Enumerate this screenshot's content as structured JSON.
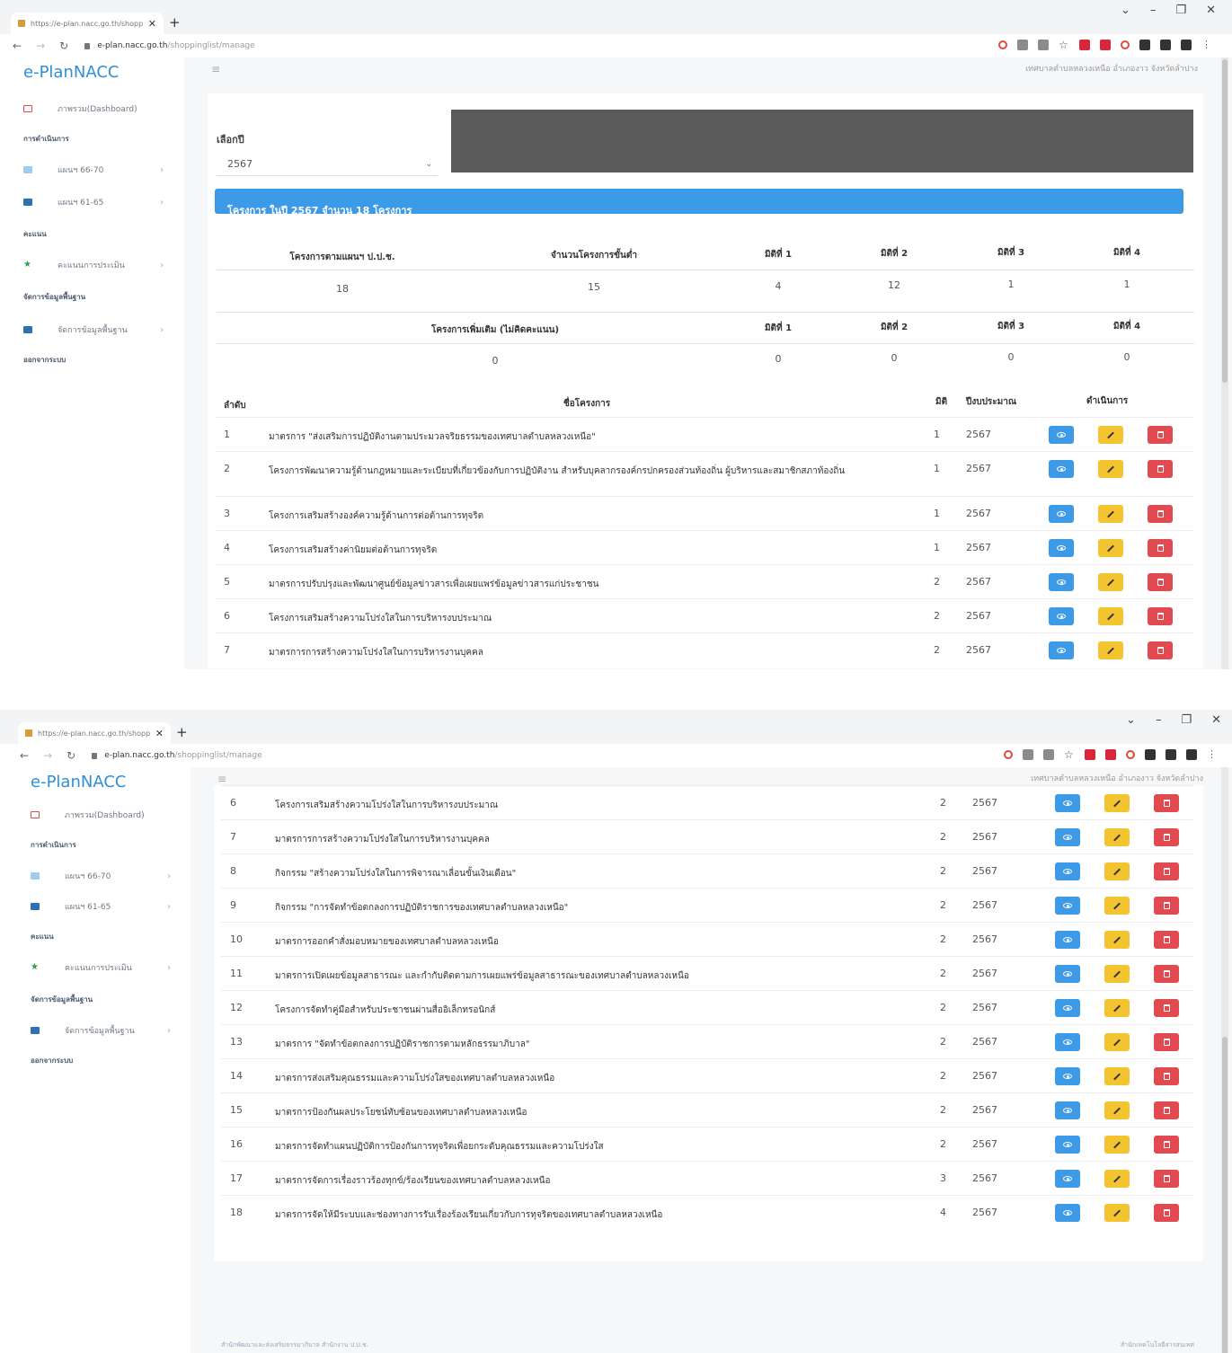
{
  "browser": {
    "tab_title": "https://e-plan.nacc.go.th/shopp",
    "url_host": "e-plan.nacc.go.th",
    "url_path": "/shoppinglist/manage"
  },
  "app": {
    "brand": "e-PlanNACC",
    "org_name": "เทศบาลตำบลหลวงเหนือ อำเภองาว จังหวัดลำปาง"
  },
  "sidebar": {
    "dashboard": "ภาพรวม(Dashboard)",
    "section_operations": "การดำเนินการ",
    "plan_66_70": "แผนฯ 66-70",
    "plan_61_65": "แผนฯ 61-65",
    "section_score": "คะแนน",
    "score_assess": "คะแนนการประเมิน",
    "section_basic": "จัดการข้อมูลพื้นฐาน",
    "basic_manage": "จัดการข้อมูลพื้นฐาน",
    "logout": "ออกจากระบบ"
  },
  "filter": {
    "year_label": "เลือกปี",
    "year_value": "2567"
  },
  "banner": "โครงการ ในปี 2567 จำนวน 18 โครงการ",
  "summary": {
    "headers_main": [
      "โครงการตามแผนฯ ป.ป.ช.",
      "จำนวนโครงการขั้นต่ำ",
      "มิติที่ 1",
      "มิติที่ 2",
      "มิติที่ 3",
      "มิติที่ 4"
    ],
    "values_main": [
      "18",
      "15",
      "4",
      "12",
      "1",
      "1"
    ],
    "headers_extra": [
      "โครงการเพิ่มเติม (ไม่คิดคะแนน)",
      "มิติที่ 1",
      "มิติที่ 2",
      "มิติที่ 3",
      "มิติที่ 4"
    ],
    "values_extra": [
      "0",
      "0",
      "0",
      "0",
      "0"
    ]
  },
  "table": {
    "headers": {
      "no": "ลำดับ",
      "name": "ชื่อโครงการ",
      "dim": "มิติ",
      "year": "ปีงบประมาณ",
      "actions": "ดำเนินการ"
    },
    "rows": [
      {
        "no": "1",
        "name": "มาตรการ \"ส่งเสริมการปฏิบัติงานตามประมวลจริยธรรมของเทศบาลตำบลหลวงเหนือ\"",
        "dim": "1",
        "year": "2567"
      },
      {
        "no": "2",
        "name": "โครงการพัฒนาความรู้ด้านกฎหมายและระเบียบที่เกี่ยวข้องกับการปฏิบัติงาน สำหรับบุคลากรองค์กรปกครองส่วนท้องถิ่น ผู้บริหารและสมาชิกสภาท้องถิ่น",
        "dim": "1",
        "year": "2567"
      },
      {
        "no": "3",
        "name": "โครงการเสริมสร้างองค์ความรู้ด้านการต่อต้านการทุจริต",
        "dim": "1",
        "year": "2567"
      },
      {
        "no": "4",
        "name": "โครงการเสริมสร้างค่านิยมต่อต้านการทุจริต",
        "dim": "1",
        "year": "2567"
      },
      {
        "no": "5",
        "name": "มาตรการปรับปรุงและพัฒนาศูนย์ข้อมูลข่าวสารเพื่อเผยแพร่ข้อมูลข่าวสารแก่ประชาชน",
        "dim": "2",
        "year": "2567"
      },
      {
        "no": "6",
        "name": "โครงการเสริมสร้างความโปร่งใสในการบริหารงบประมาณ",
        "dim": "2",
        "year": "2567"
      },
      {
        "no": "7",
        "name": "มาตรการการสร้างความโปร่งใสในการบริหารงานบุคคล",
        "dim": "2",
        "year": "2567"
      },
      {
        "no": "8",
        "name": "กิจกรรม \"สร้างความโปร่งใสในการพิจารณาเลื่อนขั้นเงินเดือน\"",
        "dim": "2",
        "year": "2567"
      },
      {
        "no": "9",
        "name": "กิจกรรม \"การจัดทำข้อตกลงการปฏิบัติราชการของเทศบาลตำบลหลวงเหนือ\"",
        "dim": "2",
        "year": "2567"
      },
      {
        "no": "10",
        "name": "มาตรการออกคำสั่งมอบหมายของเทศบาลตำบลหลวงเหนือ",
        "dim": "2",
        "year": "2567"
      },
      {
        "no": "11",
        "name": "มาตรการเปิดเผยข้อมูลสาธารณะ และกำกับติดตามการเผยแพร่ข้อมูลสาธารณะของเทศบาลตำบลหลวงเหนือ",
        "dim": "2",
        "year": "2567"
      },
      {
        "no": "12",
        "name": "โครงการจัดทำคู่มือสำหรับประชาชนผ่านสื่ออิเล็กทรอนิกส์",
        "dim": "2",
        "year": "2567"
      },
      {
        "no": "13",
        "name": "มาตรการ \"จัดทำข้อตกลงการปฏิบัติราชการตามหลักธรรมาภิบาล\"",
        "dim": "2",
        "year": "2567"
      },
      {
        "no": "14",
        "name": "มาตรการส่งเสริมคุณธรรมและความโปร่งใสของเทศบาลตำบลหลวงเหนือ",
        "dim": "2",
        "year": "2567"
      },
      {
        "no": "15",
        "name": "มาตรการป้องกันผลประโยชน์ทับซ้อนของเทศบาลตำบลหลวงเหนือ",
        "dim": "2",
        "year": "2567"
      },
      {
        "no": "16",
        "name": "มาตรการจัดทำแผนปฏิบัติการป้องกันการทุจริตเพื่อยกระดับคุณธรรมและความโปร่งใส",
        "dim": "2",
        "year": "2567"
      },
      {
        "no": "17",
        "name": "มาตรการจัดการเรื่องราวร้องทุกข์/ร้องเรียนของเทศบาลตำบลหลวงเหนือ",
        "dim": "3",
        "year": "2567"
      },
      {
        "no": "18",
        "name": "มาตรการจัดให้มีระบบและช่องทางการรับเรื่องร้องเรียนเกี่ยวกับการทุจริตของเทศบาลตำบลหลวงเหนือ",
        "dim": "4",
        "year": "2567"
      }
    ]
  },
  "footer": {
    "left": "สำนักพัฒนาและส่งเสริมธรรมาภิบาล สำนักงาน ป.ป.ช.",
    "right": "สำนักเทคโนโลยีสารสนเทศ"
  },
  "colors": {
    "primary": "#3d9ae6",
    "warning": "#f4c430",
    "danger": "#e24a52",
    "brand": "#2f8fd8"
  }
}
